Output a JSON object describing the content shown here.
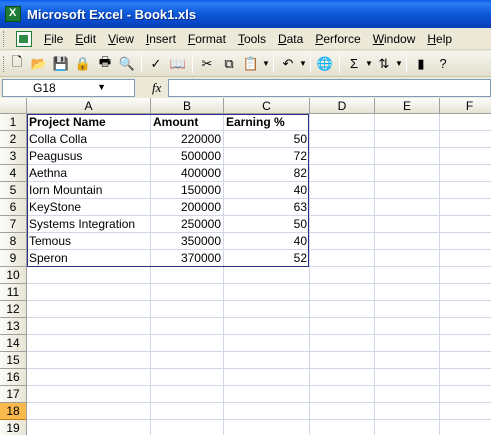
{
  "window": {
    "title": "Microsoft Excel - Book1.xls"
  },
  "menu": [
    "File",
    "Edit",
    "View",
    "Insert",
    "Format",
    "Tools",
    "Data",
    "Perforce",
    "Window",
    "Help"
  ],
  "toolbar": [
    {
      "name": "new-icon",
      "glyph": "🗋"
    },
    {
      "name": "open-icon",
      "glyph": "📂"
    },
    {
      "name": "save-icon",
      "glyph": "💾"
    },
    {
      "name": "permission-icon",
      "glyph": "🔒"
    },
    {
      "name": "print-icon",
      "glyph": "🖶"
    },
    {
      "name": "print-preview-icon",
      "glyph": "🔍"
    },
    {
      "name": "spelling-icon",
      "glyph": "✓"
    },
    {
      "name": "research-icon",
      "glyph": "📖"
    },
    {
      "name": "cut-icon",
      "glyph": "✂"
    },
    {
      "name": "copy-icon",
      "glyph": "⧉"
    },
    {
      "name": "paste-icon",
      "glyph": "📋"
    },
    {
      "name": "undo-icon",
      "glyph": "↶"
    },
    {
      "name": "hyperlink-icon",
      "glyph": "🌐"
    },
    {
      "name": "autosum-icon",
      "glyph": "Σ"
    },
    {
      "name": "sort-ascending-icon",
      "glyph": "⇅"
    },
    {
      "name": "chart-wizard-icon",
      "glyph": "▮"
    },
    {
      "name": "help-icon",
      "glyph": "?"
    }
  ],
  "formula_bar": {
    "name_box": "G18",
    "fx": "fx",
    "formula": ""
  },
  "columns": [
    "A",
    "B",
    "C",
    "D",
    "E",
    "F"
  ],
  "rows": [
    "1",
    "2",
    "3",
    "4",
    "5",
    "6",
    "7",
    "8",
    "9",
    "10",
    "11",
    "12",
    "13",
    "14",
    "15",
    "16",
    "17",
    "18",
    "19"
  ],
  "active_row": "18",
  "table": {
    "headers": [
      "Project Name",
      "Amount",
      "Earning %"
    ],
    "rows": [
      [
        "Colla Colla",
        "220000",
        "50"
      ],
      [
        "Peagusus",
        "500000",
        "72"
      ],
      [
        "Aethna",
        "400000",
        "82"
      ],
      [
        "Iorn Mountain",
        "150000",
        "40"
      ],
      [
        "KeyStone",
        "200000",
        "63"
      ],
      [
        "Systems Integration",
        "250000",
        "50"
      ],
      [
        "Temous",
        "350000",
        "40"
      ],
      [
        "Speron",
        "370000",
        "52"
      ]
    ]
  },
  "colors": {
    "title_bar": "#0a5fe8",
    "active_row_header": "#f9b94d",
    "table_border": "#2a2f8a"
  }
}
